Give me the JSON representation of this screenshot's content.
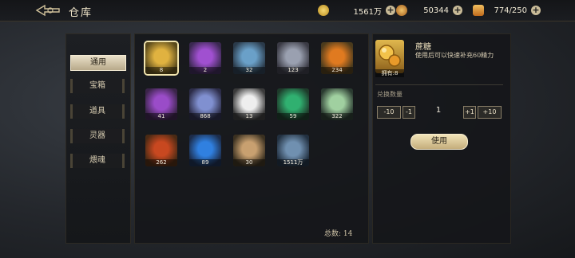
{
  "header": {
    "title": "仓库",
    "resources": [
      {
        "icon": "gold-coin-icon",
        "value": "1561万",
        "color": "#e6c04a"
      },
      {
        "icon": "gem-ring-icon",
        "value": "50344",
        "color": "#d99a3a"
      },
      {
        "icon": "energy-scroll-icon",
        "value": "774/250",
        "color": "#e0a040"
      }
    ]
  },
  "tabs": [
    "通用",
    "宝箱",
    "道具",
    "灵器",
    "煨魂"
  ],
  "inventory": {
    "items": [
      {
        "count": "8",
        "icon": "sugar-orb-icon",
        "color": "#e0b240"
      },
      {
        "count": "2",
        "icon": "purple-gem-icon",
        "color": "#a050d0"
      },
      {
        "count": "32",
        "icon": "crystal-flask-icon",
        "color": "#6aa0c8"
      },
      {
        "count": "123",
        "icon": "silver-flask-icon",
        "color": "#9aa0b0"
      },
      {
        "count": "234",
        "icon": "phoenix-feather-icon",
        "color": "#e07a20"
      },
      {
        "count": "41",
        "icon": "purple-rune-icon",
        "color": "#9a4cc8"
      },
      {
        "count": "868",
        "icon": "spirit-orb-icon",
        "color": "#8090d0"
      },
      {
        "count": "13",
        "icon": "ghost-egg-icon",
        "color": "#eeeeee"
      },
      {
        "count": "59",
        "icon": "green-prism-icon",
        "color": "#30b070"
      },
      {
        "count": "322",
        "icon": "jade-lotus-icon",
        "color": "#a0d0a0"
      },
      {
        "count": "262",
        "icon": "red-triangle-icon",
        "color": "#c84820"
      },
      {
        "count": "89",
        "icon": "blue-triangle-icon",
        "color": "#3080e0"
      },
      {
        "count": "30",
        "icon": "amber-crystal-icon",
        "color": "#c8a070"
      },
      {
        "count": "1511万",
        "icon": "sword-relic-icon",
        "color": "#7090b0"
      }
    ],
    "total_label": "总数: 14"
  },
  "detail": {
    "name": "蔗糖",
    "description": "使用后可以快速补充60精力",
    "owned_label": "拥有:8",
    "quantity_label": "兑换数量",
    "minus10": "-10",
    "minus1": "-1",
    "quantity": "1",
    "plus1": "+1",
    "plus10": "+10",
    "use_label": "使用"
  }
}
